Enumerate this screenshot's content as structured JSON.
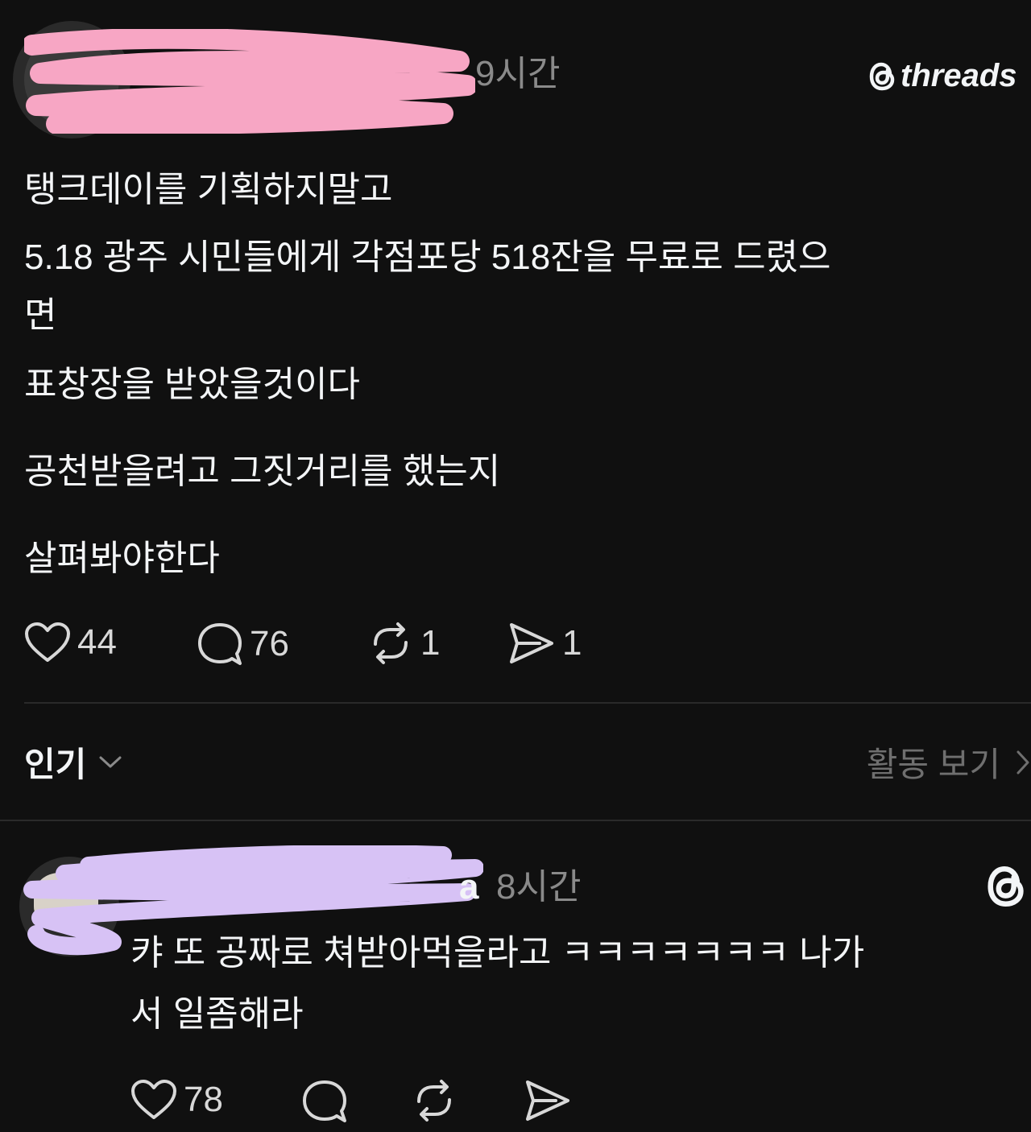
{
  "post": {
    "time": "9시간",
    "brand": "threads",
    "lines": [
      "탱크데이를 기획하지말고",
      "5.18 광주 시민들에게 각점포당 518잔을 무료로 드렸으",
      "면",
      "표창장을 받았을것이다",
      "공천받을려고 그짓거리를 했는지",
      "살펴봐야한다"
    ],
    "stats": {
      "likes": "44",
      "replies": "76",
      "reposts": "1",
      "shares": "1"
    }
  },
  "sort": {
    "label": "인기",
    "activity_label": "활동 보기"
  },
  "reply": {
    "username_visible_tail": "a",
    "time": "8시간",
    "lines": [
      "캬 또 공짜로 쳐받아먹을라고 ㅋㅋㅋㅋㅋㅋㅋ 나가",
      "서 일좀해라"
    ],
    "stats": {
      "likes": "78"
    }
  },
  "colors": {
    "background": "#101010",
    "text": "#f3f5f7",
    "muted": "#8a8a8a",
    "redaction_pink": "#f7a6c4",
    "redaction_purple": "#d7c2f5"
  }
}
